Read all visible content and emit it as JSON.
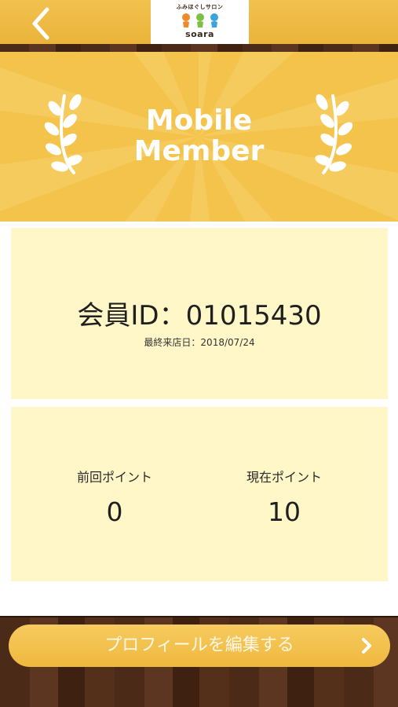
{
  "header": {
    "back_icon": "chevron-left-icon",
    "logo_tagline": "ふみほぐしサロン",
    "logo_word": "soara"
  },
  "banner": {
    "title_line1": "Mobile",
    "title_line2": "Member",
    "laurel_icon": "laurel-branch-icon"
  },
  "member": {
    "id_label": "会員ID：",
    "id_value": "01015430",
    "last_visit_label": "最終来店日：",
    "last_visit_value": "2018/07/24"
  },
  "points": {
    "previous_label": "前回ポイント",
    "previous_value": "0",
    "current_label": "現在ポイント",
    "current_value": "10"
  },
  "footer": {
    "profile_button_label": "プロフィールを編集する",
    "profile_button_icon": "chevron-right-icon"
  },
  "colors": {
    "header": "#eab43a",
    "banner": "#f4c34c",
    "card": "#fff7c8",
    "wood": "#4b2b17",
    "button": "#efb83e"
  }
}
